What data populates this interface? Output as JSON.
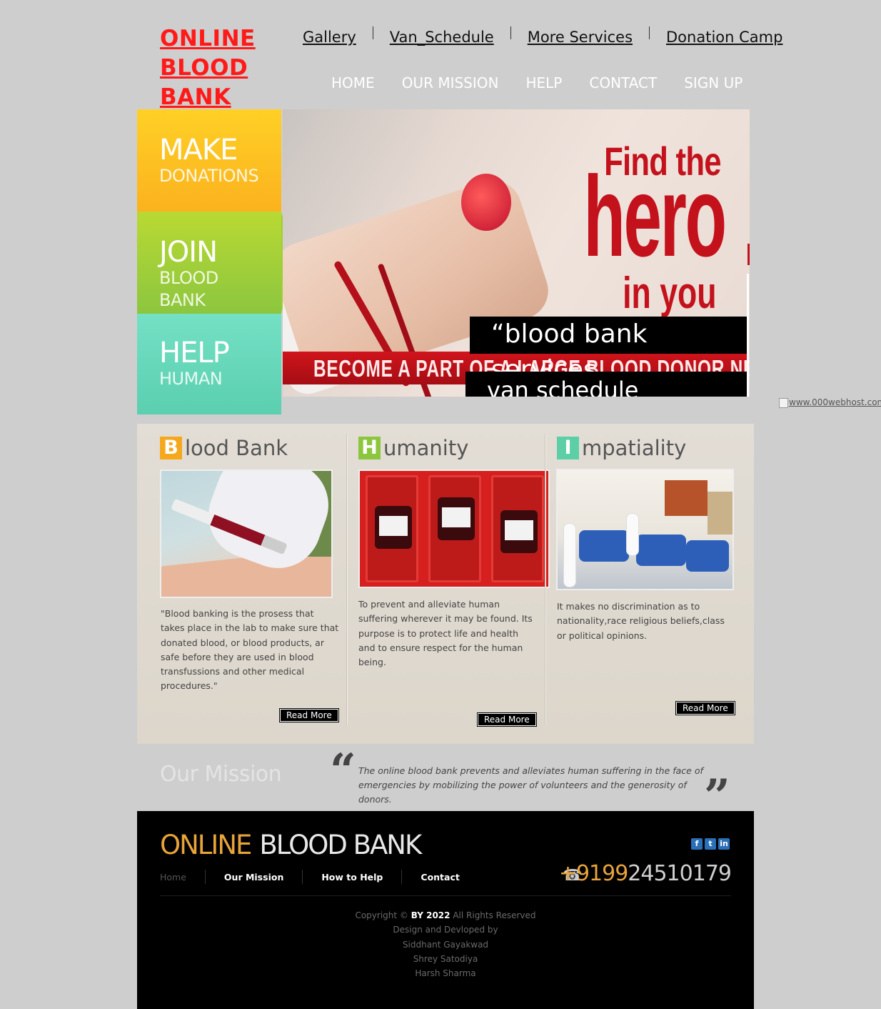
{
  "logo": {
    "line1": "ONLINE",
    "line2": "BLOOD",
    "line3": "BANK"
  },
  "top_links": [
    "Gallery",
    "Van_Schedule",
    "More Services",
    "Donation Camp"
  ],
  "main_nav": [
    "HOME",
    "OUR MISSION",
    "HELP",
    "CONTACT",
    "SIGN UP"
  ],
  "tiles": [
    {
      "big": "MAKE",
      "small": "DONATIONS",
      "small2": ""
    },
    {
      "big": "JOIN",
      "small": "BLOOD",
      "small2": "BANK"
    },
    {
      "big": "HELP",
      "small": "HUMAN",
      "small2": ""
    }
  ],
  "hero": {
    "find": "Find the",
    "word": "hero",
    "inyou": "in you",
    "banner": "BECOME A PART OF A LARGE BLOOD DONOR NETWORK",
    "box1": "“blood bank services",
    "box2": "van schedule services”"
  },
  "broken_image": {
    "alt": "www.000webhost.com"
  },
  "columns": [
    {
      "initial": "B",
      "rest": "lood Bank",
      "color": "#f5a81c",
      "text": "\"Blood banking is the prosess that takes place in the lab to make sure that donated blood, or blood products, ar safe before they are used in blood transfussions and other medical procedures.\"",
      "read_more": "Read More"
    },
    {
      "initial": "H",
      "rest": "umanity",
      "color": "#8cc63f",
      "text": "To prevent and alleviate human suffering wherever it may be found. Its purpose is to protect life and health and to ensure respect for the human being.",
      "read_more": "Read More"
    },
    {
      "initial": "I",
      "rest": "mpatiality",
      "color": "#5ccfa6",
      "text": "It makes no discrimination as to nationality,race religious beliefs,class or political opinions.",
      "read_more": "Read More"
    }
  ],
  "mission": {
    "title": "Our Mission",
    "open_quote": "“",
    "close_quote": "”",
    "text": "The online blood bank prevents and alleviates human suffering in the face of emergencies by mobilizing the power of volunteers and the generosity of donors."
  },
  "footer": {
    "logo_a": "ONLINE",
    "logo_b": "BLOOD BANK",
    "social": [
      "f",
      "t",
      "in"
    ],
    "nav": [
      "Home",
      "Our Mission",
      "How to Help",
      "Contact"
    ],
    "phone_icon": "☎",
    "phone_a": "+9199",
    "phone_b": "24510179",
    "copyright_pre": "Copyright ©",
    "copyright_hl": "BY 2022",
    "copyright_post": "All Rights Reserved",
    "credits": [
      "Design and Devloped by",
      "Siddhant Gayakwad",
      "Shrey Satodiya",
      "Harsh Sharma"
    ]
  }
}
